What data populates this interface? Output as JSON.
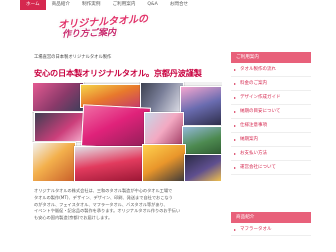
{
  "nav": {
    "items": [
      {
        "label": "ホーム",
        "active": true
      },
      {
        "label": "商品紹介",
        "active": false
      },
      {
        "label": "制作実例",
        "active": false
      },
      {
        "label": "ご利用案内",
        "active": false
      },
      {
        "label": "Q&A",
        "active": false
      },
      {
        "label": "お問合せ",
        "active": false
      }
    ]
  },
  "logo": {
    "line1": "オリジナルタオルの",
    "line2": "作り方ご案内"
  },
  "subline": "工場直営の日本製オリジナルタオル製作",
  "headline": "安心の日本製オリジナルタオル。京都丹波謹製",
  "description": [
    "オリジナルタオルの株式会社は、三和のタオル製造が中心のタオル工場で",
    "タオルの製作(MT)、デザイン、デザイン、印刷、発送まで自社でおこなう",
    "のがタオル、フェイスタオル、マフラータオル、バスタオル等があり、",
    "イベントや販促・記念品の製作を承ります。オリジナルタオル作りのお手伝い",
    "も安心の国内製造(京都)でお届けします。"
  ],
  "sidebar": {
    "heading": "ご利用案内",
    "items": [
      "タオル製作の流れ",
      "料金のご案内",
      "デザイン作成ガイド",
      "納期の目安について",
      "仕様注意事項",
      "納期案内",
      "お支払い方法",
      "運営会社について"
    ],
    "heading2": "商品紹介",
    "items2": [
      "マフラータオル"
    ]
  },
  "colors": {
    "accent": "#d5284f",
    "sidebar_header": "#e8607a",
    "headline": "#c8003f"
  }
}
